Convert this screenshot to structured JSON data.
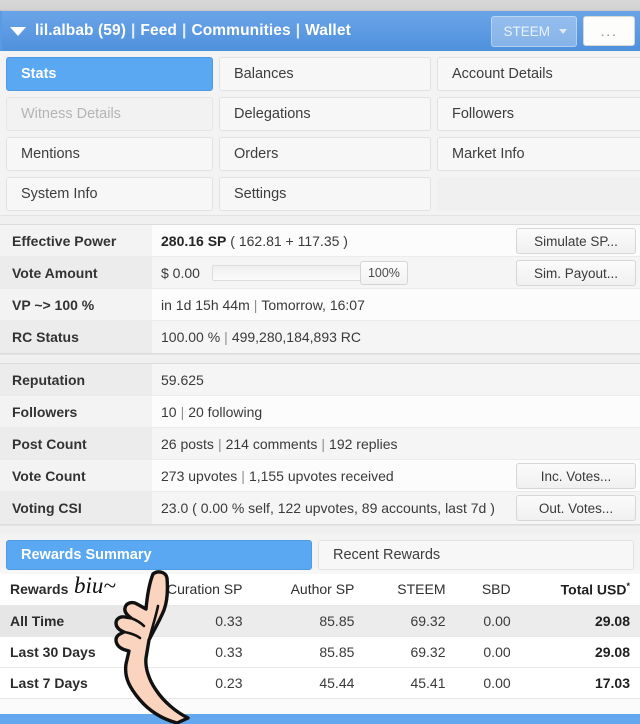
{
  "header": {
    "caret_icon": "caret-down-icon",
    "username": "lil.albab (59)",
    "links": [
      "Feed",
      "Communities",
      "Wallet"
    ],
    "separator": "|",
    "currency_label": "STEEM",
    "currency_caret_icon": "caret-down-icon",
    "more_label": "...",
    "accent_color": "#5a9ae3"
  },
  "tabs": [
    {
      "label": "Stats",
      "state": "active"
    },
    {
      "label": "Balances",
      "state": "normal"
    },
    {
      "label": "Account Details",
      "state": "normal"
    },
    {
      "label": "Witness Details",
      "state": "disabled"
    },
    {
      "label": "Delegations",
      "state": "normal"
    },
    {
      "label": "Followers",
      "state": "normal"
    },
    {
      "label": "Mentions",
      "state": "normal"
    },
    {
      "label": "Orders",
      "state": "normal"
    },
    {
      "label": "Market Info",
      "state": "normal"
    },
    {
      "label": "System Info",
      "state": "normal"
    },
    {
      "label": "Settings",
      "state": "normal"
    },
    {
      "label": "",
      "state": "empty"
    }
  ],
  "stats_primary": {
    "effective_power": {
      "label": "Effective Power",
      "value_bold": "280.16 SP",
      "value_rest": "( 162.81 + 117.35 )",
      "button": "Simulate SP..."
    },
    "vote_amount": {
      "label": "Vote Amount",
      "amount": "$ 0.00",
      "slider_value": "100%",
      "slider_percent": 100,
      "button": "Sim. Payout..."
    },
    "vp": {
      "label": "VP ~> 100 %",
      "value_a": "in 1d 15h 44m",
      "value_b": "Tomorrow, 16:07"
    },
    "rc_status": {
      "label": "RC Status",
      "value_a": "100.00 %",
      "value_b": "499,280,184,893 RC"
    }
  },
  "stats_secondary": {
    "reputation": {
      "label": "Reputation",
      "value": "59.625"
    },
    "followers": {
      "label": "Followers",
      "value_a": "10",
      "value_b": "20 following"
    },
    "post_count": {
      "label": "Post Count",
      "value_a": "26 posts",
      "value_b": "214 comments",
      "value_c": "192 replies"
    },
    "vote_count": {
      "label": "Vote Count",
      "value_a": "273 upvotes",
      "value_b": "1,155 upvotes received",
      "button": "Inc. Votes..."
    },
    "voting_csi": {
      "label": "Voting CSI",
      "value": "23.0 ( 0.00 % self, 122 upvotes, 89 accounts, last 7d )",
      "button": "Out. Votes..."
    }
  },
  "rewards": {
    "tabs": [
      {
        "label": "Rewards Summary",
        "state": "active"
      },
      {
        "label": "Recent Rewards",
        "state": "normal"
      }
    ],
    "columns": [
      "Rewards",
      "Curation SP",
      "Author SP",
      "STEEM",
      "SBD",
      "Total USD"
    ],
    "total_usd_superscript": "*",
    "rows": [
      {
        "period": "All Time",
        "curation_sp": "0.33",
        "author_sp": "85.85",
        "steem": "69.32",
        "sbd": "0.00",
        "total_usd": "29.08"
      },
      {
        "period": "Last 30 Days",
        "curation_sp": "0.33",
        "author_sp": "85.85",
        "steem": "69.32",
        "sbd": "0.00",
        "total_usd": "29.08"
      },
      {
        "period": "Last 7 Days",
        "curation_sp": "0.23",
        "author_sp": "45.44",
        "steem": "45.41",
        "sbd": "0.00",
        "total_usd": "17.03"
      }
    ]
  },
  "annotation": {
    "text": "biu~",
    "icon": "pointing-hand-illustration"
  }
}
